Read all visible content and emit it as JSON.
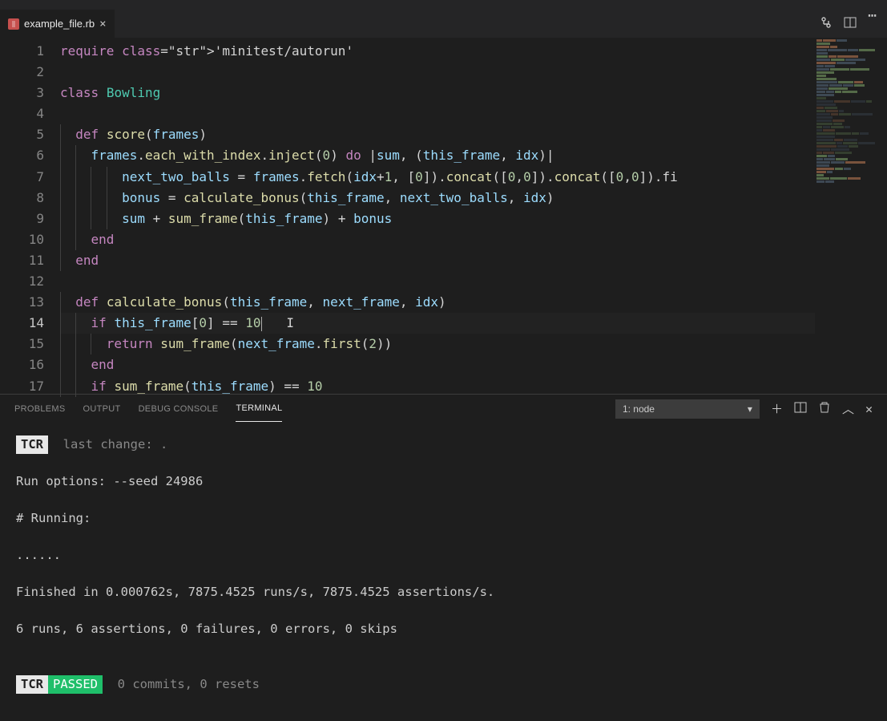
{
  "tab": {
    "filename": "example_file.rb"
  },
  "editor": {
    "lines": [
      {
        "n": 1,
        "raw": "require 'minitest/autorun'"
      },
      {
        "n": 2,
        "raw": ""
      },
      {
        "n": 3,
        "raw": "class Bowling"
      },
      {
        "n": 4,
        "raw": ""
      },
      {
        "n": 5,
        "raw": "  def score(frames)"
      },
      {
        "n": 6,
        "raw": "    frames.each_with_index.inject(0) do |sum, (this_frame, idx)|"
      },
      {
        "n": 7,
        "raw": "        next_two_balls = frames.fetch(idx+1, [0]).concat([0,0]).concat([0,0]).fi"
      },
      {
        "n": 8,
        "raw": "        bonus = calculate_bonus(this_frame, next_two_balls, idx)"
      },
      {
        "n": 9,
        "raw": "        sum + sum_frame(this_frame) + bonus"
      },
      {
        "n": 10,
        "raw": "    end"
      },
      {
        "n": 11,
        "raw": "  end"
      },
      {
        "n": 12,
        "raw": ""
      },
      {
        "n": 13,
        "raw": "  def calculate_bonus(this_frame, next_frame, idx)"
      },
      {
        "n": 14,
        "raw": "    if this_frame[0] == 10"
      },
      {
        "n": 15,
        "raw": "      return sum_frame(next_frame.first(2))"
      },
      {
        "n": 16,
        "raw": "    end"
      },
      {
        "n": 17,
        "raw": "    if sum_frame(this_frame) == 10"
      }
    ],
    "active_line": 14
  },
  "panel": {
    "tabs": [
      "PROBLEMS",
      "OUTPUT",
      "DEBUG CONSOLE",
      "TERMINAL"
    ],
    "active_tab": "TERMINAL",
    "terminal_selector": "1: node"
  },
  "terminal": {
    "tcr_label": "TCR",
    "last_change_label": "last change: .",
    "run_options": "Run options: --seed 24986",
    "running_header": "# Running:",
    "dots": "......",
    "finished": "Finished in 0.000762s, 7875.4525 runs/s, 7875.4525 assertions/s.",
    "summary": "6 runs, 6 assertions, 0 failures, 0 errors, 0 skips",
    "passed_label": "PASSED",
    "commits_resets": "0 commits, 0 resets"
  }
}
